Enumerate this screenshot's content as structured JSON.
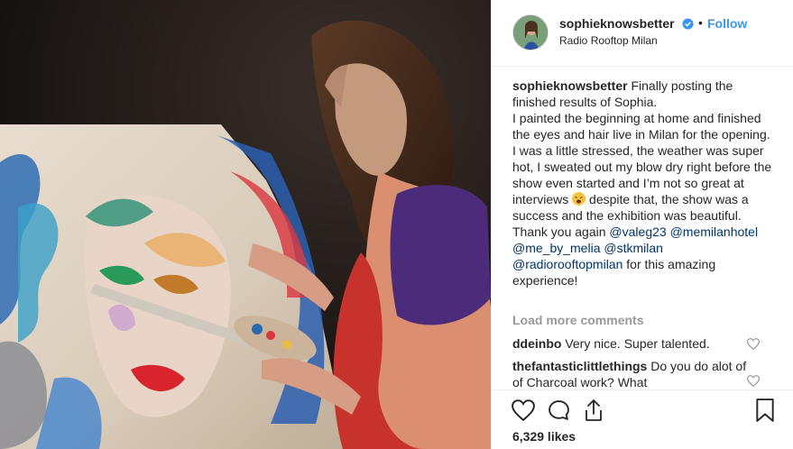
{
  "author": {
    "username": "sophieknowsbetter",
    "location": "Radio Rooftop Milan",
    "follow_label": "Follow",
    "separator": "•"
  },
  "caption": {
    "username": "sophieknowsbetter",
    "text_1": "Finally posting the finished results of Sophia.",
    "text_2": "I painted the beginning at home and finished the eyes and hair live in Milan for the opening. I was a little stressed, the weather was super hot, I sweated out my blow dry right before the show even started and I’m not so great at interviews",
    "text_3": "despite that, the show was a success and the exhibition was beautiful. Thank you again",
    "mention_1": "@valeg23",
    "mention_2": "@memilanhotel",
    "mention_3": "@me_by_melia",
    "mention_4": "@stkmilan",
    "mention_5": "@radiorooftopmilan",
    "text_4": "for this amazing experience!"
  },
  "load_more_label": "Load more comments",
  "comments": [
    {
      "username": "ddeinbo",
      "text": "Very nice. Super talented."
    },
    {
      "username": "thefantasticlittlethings",
      "text": "Do you do alot of of Charcoal work? What"
    }
  ],
  "likes_label": "6,329 likes",
  "colors": {
    "accent": "#3897f0",
    "mention": "#003569",
    "muted": "#999999"
  },
  "icons": [
    "verified-badge-icon",
    "heart-icon",
    "comment-icon",
    "share-icon",
    "bookmark-icon"
  ]
}
